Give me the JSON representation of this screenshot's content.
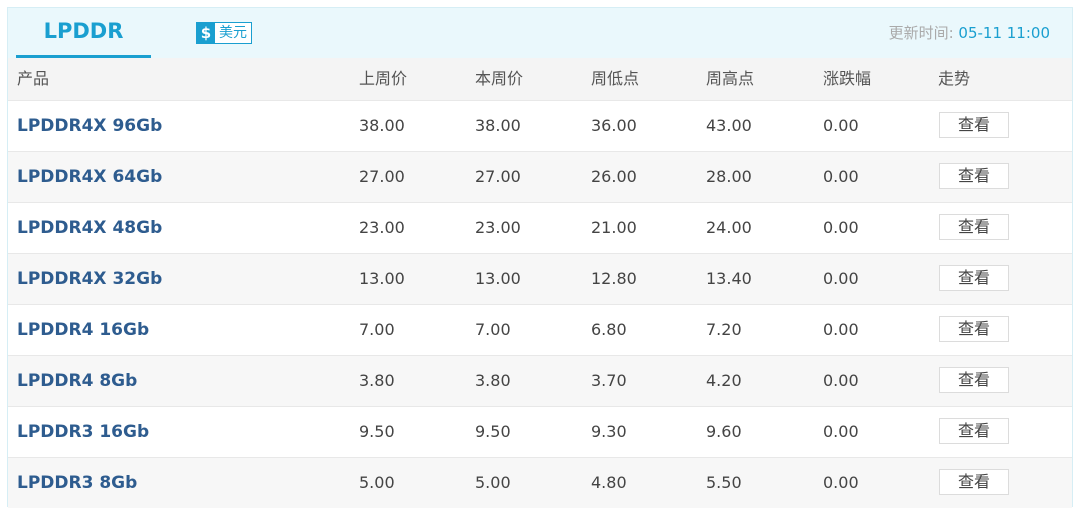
{
  "header": {
    "tab_label": "LPDDR",
    "currency_icon": "$",
    "currency_label": "美元",
    "update_prefix": "更新时间: ",
    "update_time": "05-11 11:00"
  },
  "columns": [
    "产品",
    "上周价",
    "本周价",
    "周低点",
    "周高点",
    "涨跌幅",
    "走势"
  ],
  "rows": [
    {
      "product": "LPDDR4X 96Gb",
      "prev": "38.00",
      "curr": "38.00",
      "low": "36.00",
      "high": "43.00",
      "change": "0.00",
      "trend": "查看"
    },
    {
      "product": "LPDDR4X 64Gb",
      "prev": "27.00",
      "curr": "27.00",
      "low": "26.00",
      "high": "28.00",
      "change": "0.00",
      "trend": "查看"
    },
    {
      "product": "LPDDR4X 48Gb",
      "prev": "23.00",
      "curr": "23.00",
      "low": "21.00",
      "high": "24.00",
      "change": "0.00",
      "trend": "查看"
    },
    {
      "product": "LPDDR4X 32Gb",
      "prev": "13.00",
      "curr": "13.00",
      "low": "12.80",
      "high": "13.40",
      "change": "0.00",
      "trend": "查看"
    },
    {
      "product": "LPDDR4 16Gb",
      "prev": "7.00",
      "curr": "7.00",
      "low": "6.80",
      "high": "7.20",
      "change": "0.00",
      "trend": "查看"
    },
    {
      "product": "LPDDR4 8Gb",
      "prev": "3.80",
      "curr": "3.80",
      "low": "3.70",
      "high": "4.20",
      "change": "0.00",
      "trend": "查看"
    },
    {
      "product": "LPDDR3 16Gb",
      "prev": "9.50",
      "curr": "9.50",
      "low": "9.30",
      "high": "9.60",
      "change": "0.00",
      "trend": "查看"
    },
    {
      "product": "LPDDR3 8Gb",
      "prev": "5.00",
      "curr": "5.00",
      "low": "4.80",
      "high": "5.50",
      "change": "0.00",
      "trend": "查看"
    }
  ],
  "colors": {
    "accent": "#1a9fd0",
    "product_link": "#2e5c8f",
    "header_bg": "#eaf8fc"
  }
}
